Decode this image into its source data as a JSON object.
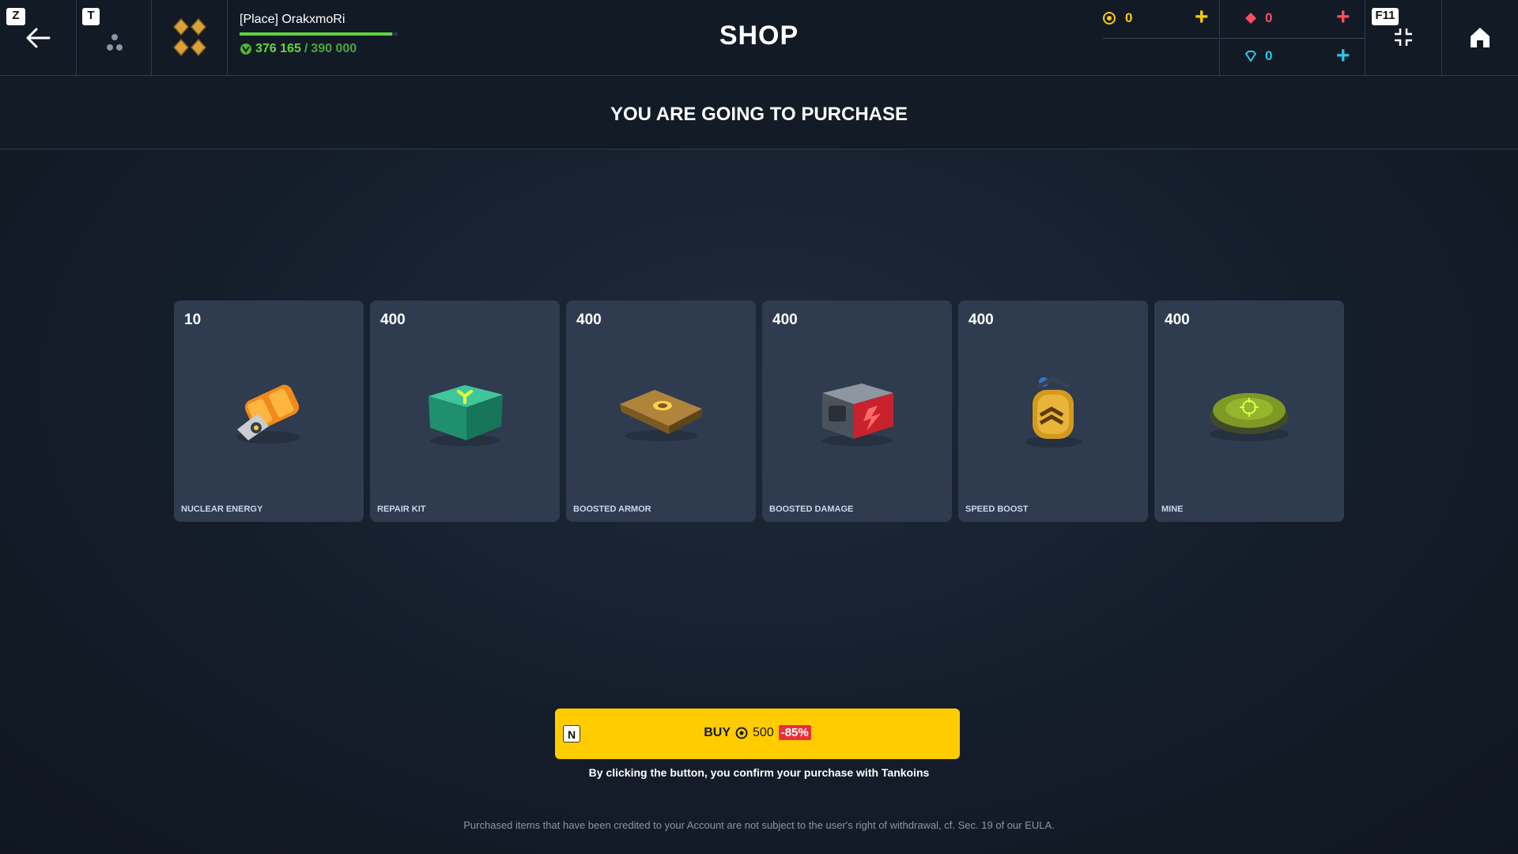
{
  "header": {
    "back_key": "Z",
    "squad_key": "T",
    "title": "SHOP",
    "fullscreen_key": "F11",
    "profile": {
      "name": "[Place] OrakxmoRi",
      "xp_current": "376 165",
      "xp_separator": "/",
      "xp_max": "390 000",
      "xp_progress": 0.9645
    },
    "currencies": {
      "crystals": "0",
      "rubies": "0",
      "diamonds": "0"
    }
  },
  "purchase": {
    "heading": "YOU ARE GOING TO PURCHASE",
    "items": [
      {
        "qty": "10",
        "name": "NUCLEAR ENERGY",
        "icon": "nuclear-energy-icon"
      },
      {
        "qty": "400",
        "name": "REPAIR KIT",
        "icon": "repair-kit-icon"
      },
      {
        "qty": "400",
        "name": "BOOSTED ARMOR",
        "icon": "boosted-armor-icon"
      },
      {
        "qty": "400",
        "name": "BOOSTED DAMAGE",
        "icon": "boosted-damage-icon"
      },
      {
        "qty": "400",
        "name": "SPEED BOOST",
        "icon": "speed-boost-icon"
      },
      {
        "qty": "400",
        "name": "MINE",
        "icon": "mine-icon"
      }
    ],
    "buy": {
      "key": "N",
      "label": "BUY",
      "price": "500",
      "discount": "-85%"
    },
    "confirm_text": "By clicking the button, you confirm your purchase with Tankoins",
    "legal_text": "Purchased items that have been credited to your Account are not subject to the user's right of withdrawal, cf. Sec. 19 of our EULA."
  },
  "colors": {
    "accent": "#ffcc00",
    "discount": "#e8313a",
    "xp": "#5fd33c",
    "ruby": "#ff4d5e",
    "diamond": "#2ac7e8"
  }
}
